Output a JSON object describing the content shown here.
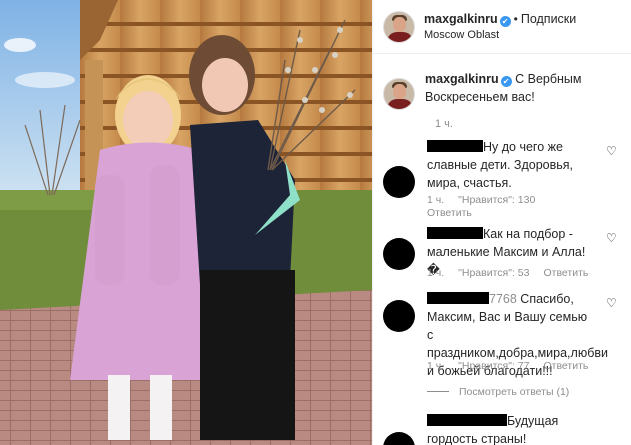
{
  "post": {
    "username": "maxgalkinru",
    "verified_mark": "✔",
    "separator": "•",
    "follow_label": "Подписки",
    "location": "Moscow Oblast"
  },
  "caption": {
    "username": "maxgalkinru",
    "verified_mark": "✔",
    "text": "С Вербным Воскресеньем вас!",
    "time": "1 ч."
  },
  "comments": [
    {
      "text": "Ну до чего же славные дети. Здоровья, мира, счастья.",
      "time": "1 ч.",
      "likes": "\"Нравится\": 130",
      "reply": "Ответить"
    },
    {
      "text": "Как на подбор - маленькие Максим и Алла!�",
      "time": "1 ч.",
      "likes": "\"Нравится\": 53",
      "reply": "Ответить"
    },
    {
      "partial_username": "7768",
      "text": "Спасибо, Максим, Вас и Вашу семью с праздником,добра,мира,любви и божьей благодати!!!",
      "time": "1 ч.",
      "likes": "\"Нравится\": 77",
      "reply": "Ответить",
      "view_replies": "Посмотреть ответы (1)"
    },
    {
      "text": "Будущая гордость страны!"
    }
  ],
  "icons": {
    "heart": "heart-outline-icon",
    "verified": "verified-badge-icon"
  },
  "colors": {
    "verified_blue": "#3897f0",
    "meta_gray": "#8e8e8e",
    "text": "#262626"
  }
}
